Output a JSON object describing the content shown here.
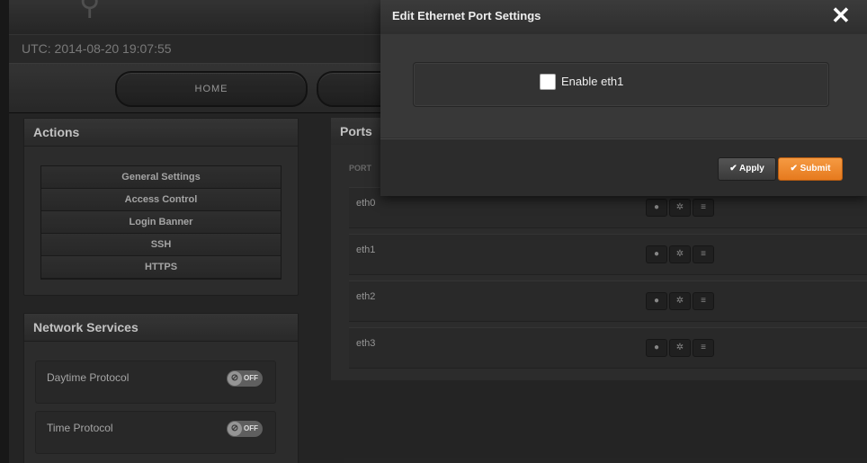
{
  "header": {
    "utc_text": "UTC: 2014-08-20 19:07:55"
  },
  "nav": {
    "home_label": "HOME"
  },
  "actions": {
    "title": "Actions",
    "items": [
      {
        "label": "General Settings"
      },
      {
        "label": "Access Control"
      },
      {
        "label": "Login Banner"
      },
      {
        "label": "SSH"
      },
      {
        "label": "HTTPS"
      }
    ]
  },
  "network_services": {
    "title": "Network Services",
    "items": [
      {
        "label": "Daytime Protocol",
        "toggle": "OFF"
      },
      {
        "label": "Time Protocol",
        "toggle": "OFF"
      }
    ]
  },
  "ports": {
    "title": "Ports",
    "column_header": "PORT",
    "rows": [
      {
        "name": "eth0"
      },
      {
        "name": "eth1"
      },
      {
        "name": "eth2"
      },
      {
        "name": "eth3"
      }
    ]
  },
  "modal": {
    "title": "Edit Ethernet Port Settings",
    "close_glyph": "✕",
    "checkbox_label": "Enable eth1",
    "checkbox_checked": false,
    "apply_label": "✔ Apply",
    "submit_label": "✔ Submit"
  },
  "icons": {
    "info": "info-icon",
    "settings": "gear-icon",
    "list": "list-icon",
    "close": "close-icon"
  },
  "colors": {
    "accent": "#f0872e"
  }
}
